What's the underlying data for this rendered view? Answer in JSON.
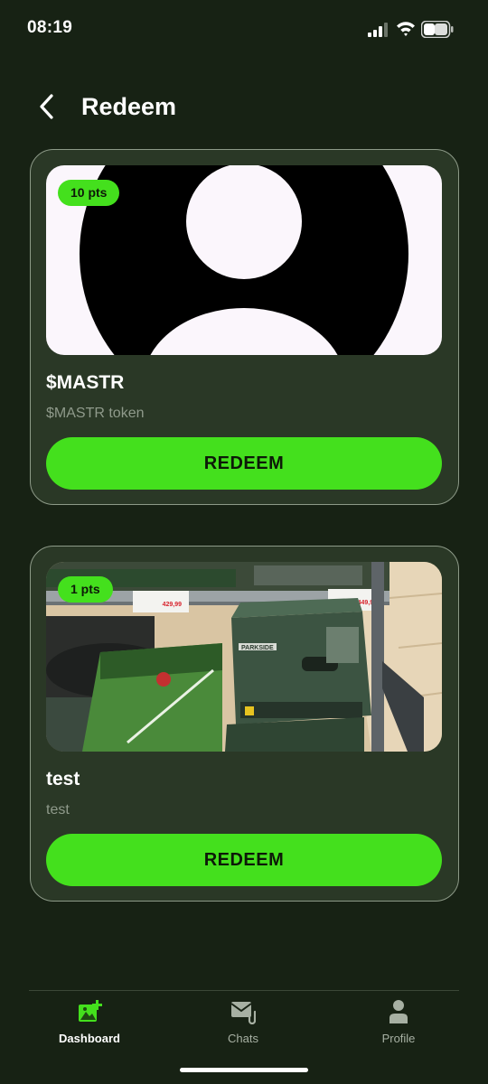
{
  "status_bar": {
    "time": "08:19"
  },
  "header": {
    "title": "Redeem"
  },
  "rewards": [
    {
      "points": "10 pts",
      "title": "$MASTR",
      "description": "$MASTR token",
      "button_label": "REDEEM"
    },
    {
      "points": "1 pts",
      "title": "test",
      "description": "test",
      "button_label": "REDEEM",
      "photo_labels": {
        "brand": "PARKSIDE",
        "price_left": "429,99",
        "price_right": "449,99"
      }
    }
  ],
  "bottom_nav": {
    "items": [
      {
        "label": "Dashboard",
        "icon": "image-plus-icon",
        "active": true
      },
      {
        "label": "Chats",
        "icon": "mail-attachment-icon",
        "active": false
      },
      {
        "label": "Profile",
        "icon": "person-icon",
        "active": false
      }
    ]
  },
  "colors": {
    "background": "#172214",
    "card": "#2a3826",
    "accent": "#44e01d",
    "muted_text": "#8f9a8b"
  }
}
